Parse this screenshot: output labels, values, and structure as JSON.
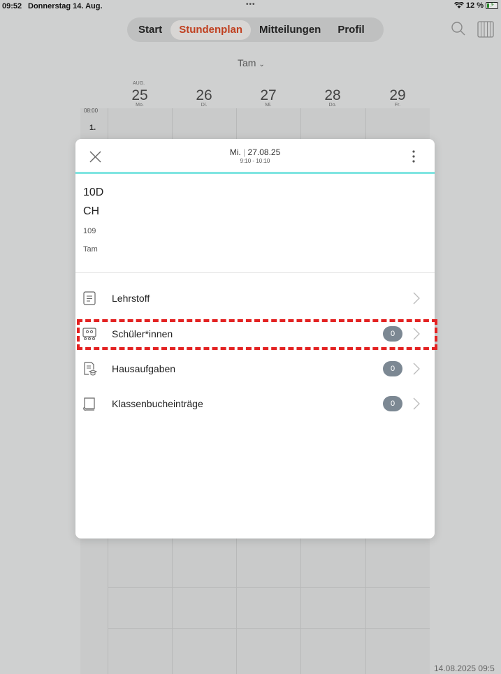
{
  "status_bar": {
    "time": "09:52",
    "date": "Donnerstag 14. Aug.",
    "dots": "•••",
    "wifi_icon": "wifi-icon",
    "battery": "12 %",
    "battery_icon": "battery-charging-icon"
  },
  "nav": {
    "tabs": [
      {
        "label": "Start",
        "active": false
      },
      {
        "label": "Stundenplan",
        "active": true
      },
      {
        "label": "Mitteilungen",
        "active": false
      },
      {
        "label": "Profil",
        "active": false
      }
    ],
    "accent_color": "#c04020",
    "search_icon": "search-icon",
    "grid_icon": "week-grid-icon"
  },
  "teacher_selector": {
    "label": "Tam"
  },
  "timetable": {
    "month": "AUG.",
    "days": [
      {
        "num": "25",
        "weekday": "Mo."
      },
      {
        "num": "26",
        "weekday": "Di."
      },
      {
        "num": "27",
        "weekday": "Mi."
      },
      {
        "num": "28",
        "weekday": "Do."
      },
      {
        "num": "29",
        "weekday": "Fr."
      }
    ],
    "first_time": "08:00",
    "first_period": "1."
  },
  "modal": {
    "date_day": "Mi.",
    "date_sep": "|",
    "date": "27.08.25",
    "time_range": "9:10 - 10:10",
    "header_accent": "#7fe5e1",
    "lesson": {
      "class": "10D",
      "subject": "CH",
      "room": "109",
      "teacher": "Tam"
    },
    "items": [
      {
        "label": "Lehrstoff",
        "icon": "document-icon",
        "badge": null
      },
      {
        "label": "Schüler*innen",
        "icon": "students-icon",
        "badge": "0"
      },
      {
        "label": "Hausaufgaben",
        "icon": "homework-icon",
        "badge": "0"
      },
      {
        "label": "Klassenbucheinträge",
        "icon": "book-icon",
        "badge": "0"
      }
    ]
  },
  "footer_timestamp": "14.08.2025 09:5",
  "highlight_color": "#e32222"
}
